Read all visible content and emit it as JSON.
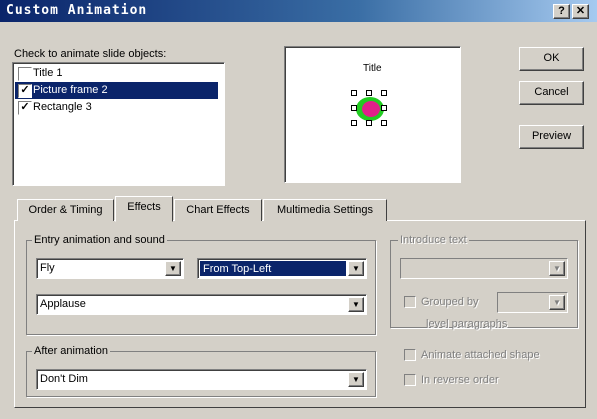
{
  "window": {
    "title": "Custom Animation",
    "help_label": "?",
    "close_label": "✕"
  },
  "objects": {
    "heading": "Check to animate slide objects:",
    "items": [
      {
        "label": "Title 1",
        "checked": false,
        "check": ""
      },
      {
        "label": "Picture frame 2",
        "checked": true,
        "check": "✓"
      },
      {
        "label": "Rectangle 3",
        "checked": true,
        "check": "✓"
      }
    ]
  },
  "preview": {
    "title_text": "Title"
  },
  "buttons": {
    "ok": "OK",
    "cancel": "Cancel",
    "preview": "Preview"
  },
  "tabs": [
    "Order & Timing",
    "Effects",
    "Chart Effects",
    "Multimedia Settings"
  ],
  "active_tab": "Effects",
  "entry": {
    "group_label": "Entry animation and sound",
    "effect": "Fly",
    "direction": "From Top-Left",
    "sound": "Applause"
  },
  "after": {
    "group_label": "After animation",
    "value": "Don't Dim"
  },
  "introduce": {
    "group_label": "Introduce text",
    "grouped_by_label": "Grouped by",
    "level_label": "level paragraphs",
    "attached_label": "Animate attached shape",
    "reverse_label": "In reverse order"
  },
  "colors": {
    "titlebar": "#0a246a",
    "selection": "#0a246a",
    "face": "#d4d0c8"
  }
}
